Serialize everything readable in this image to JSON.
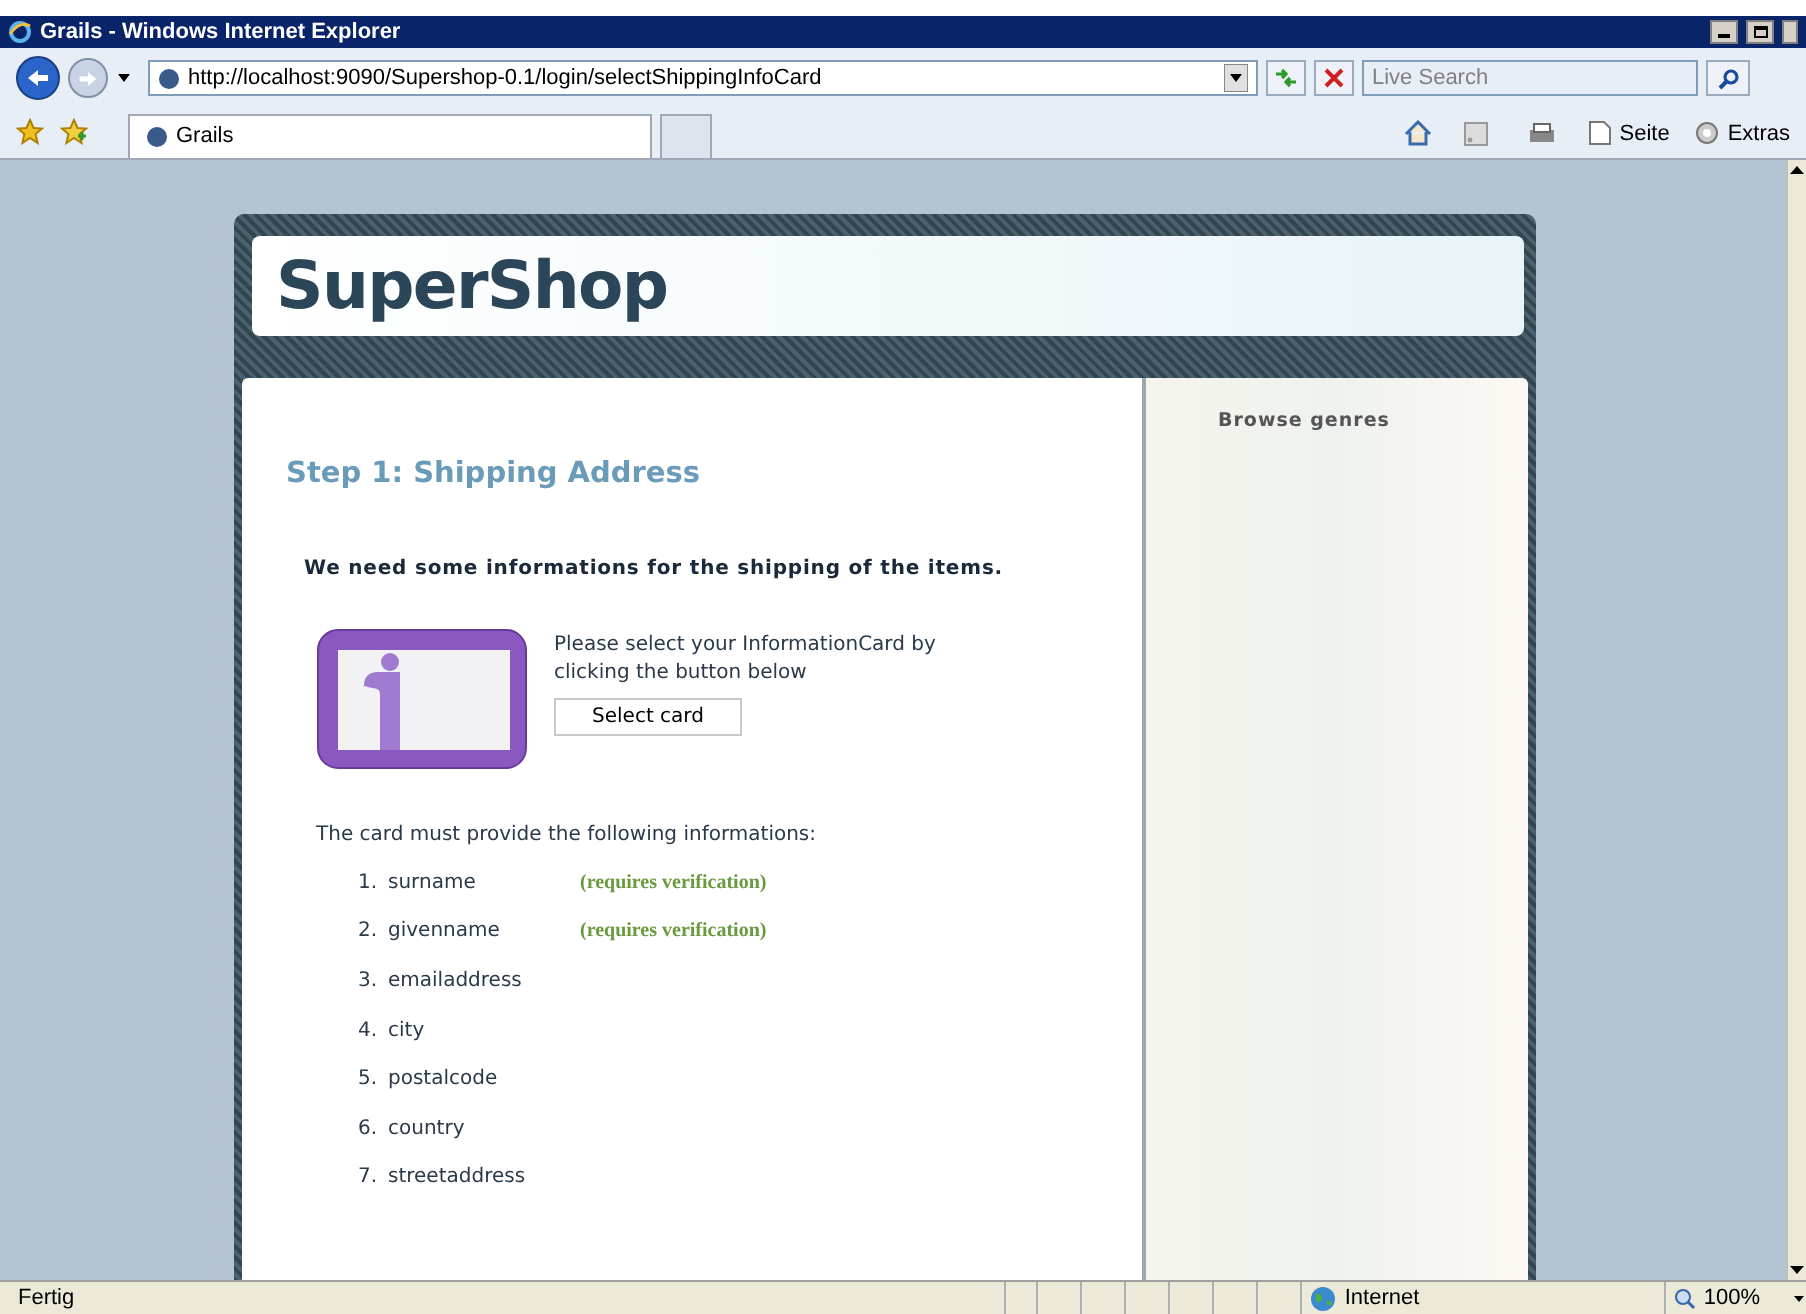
{
  "window": {
    "title": "Grails - Windows Internet Explorer"
  },
  "address_bar": {
    "url": "http://localhost:9090/Supershop-0.1/login/selectShippingInfoCard"
  },
  "search": {
    "placeholder": "Live Search"
  },
  "tabs": [
    {
      "label": "Grails",
      "selected": true
    }
  ],
  "command_bar": {
    "page": "Seite",
    "tools": "Extras"
  },
  "site": {
    "logo": "SuperShop",
    "heading": "Step 1: Shipping Address",
    "intro": "We need some informations for the shipping of the items.",
    "card_prompt": "Please select your InformationCard by clicking the button below",
    "select_button": "Select card",
    "requirements_title": "The card must provide the following informations:",
    "claims": [
      {
        "number": "1.",
        "name": "surname",
        "note": "(requires verification)"
      },
      {
        "number": "2.",
        "name": "givenname",
        "note": "(requires verification)"
      },
      {
        "number": "3.",
        "name": "emailaddress"
      },
      {
        "number": "4.",
        "name": "city"
      },
      {
        "number": "5.",
        "name": "postalcode"
      },
      {
        "number": "6.",
        "name": "country"
      },
      {
        "number": "7.",
        "name": "streetaddress"
      }
    ],
    "sidebar_title": "Browse genres"
  },
  "status_bar": {
    "text": "Fertig",
    "zone": "Internet",
    "zoom": "100%"
  }
}
